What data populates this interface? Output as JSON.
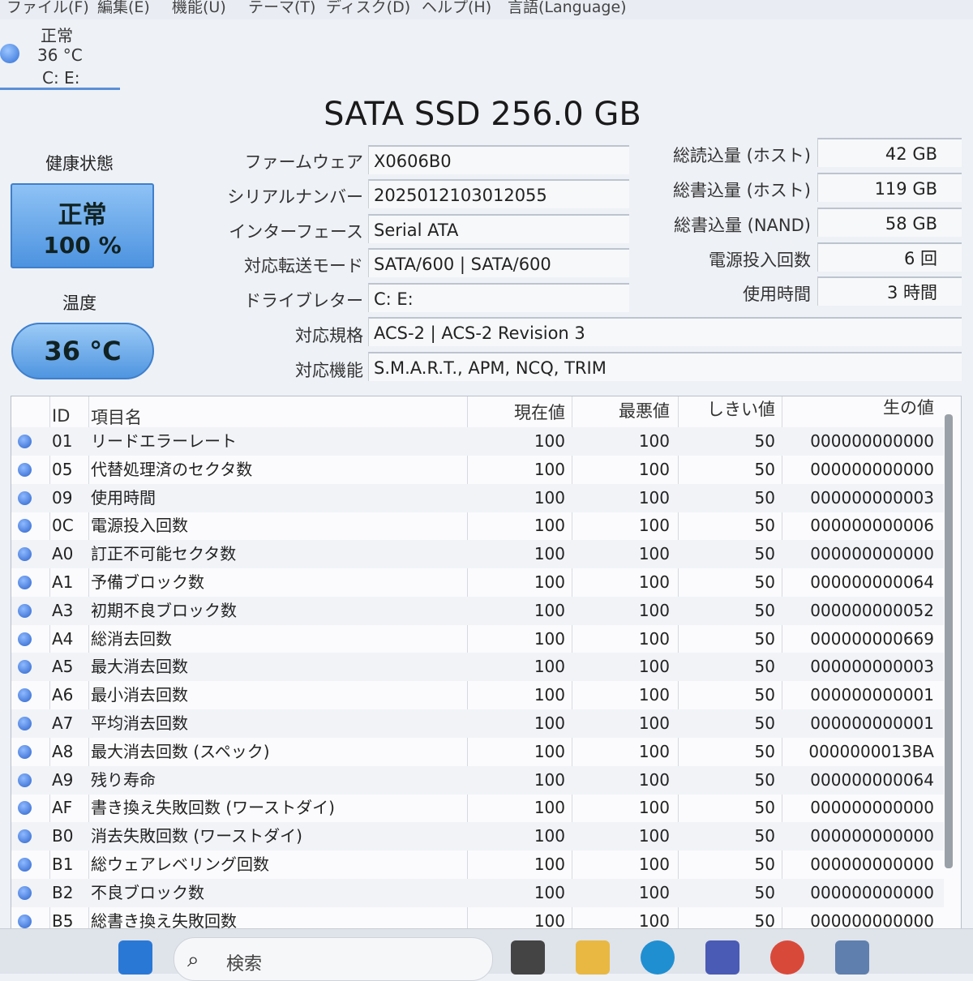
{
  "menu": [
    "ファイル(F)",
    "編集(E)",
    "機能(U)",
    "テーマ(T)",
    "ディスク(D)",
    "ヘルプ(H)",
    "言語(Language)"
  ],
  "drive_tab": {
    "status": "正常",
    "temp": "36 °C",
    "letters": "C: E:"
  },
  "title": "SATA SSD 256.0 GB",
  "health": {
    "label": "健康状態",
    "status": "正常",
    "percent": "100 %"
  },
  "temperature": {
    "label": "温度",
    "value": "36 °C"
  },
  "info_left": [
    {
      "label": "ファームウェア",
      "value": "X0606B0"
    },
    {
      "label": "シリアルナンバー",
      "value": "2025012103012055"
    },
    {
      "label": "インターフェース",
      "value": "Serial ATA"
    },
    {
      "label": "対応転送モード",
      "value": "SATA/600 | SATA/600"
    },
    {
      "label": "ドライブレター",
      "value": "C: E:"
    }
  ],
  "info_wide": [
    {
      "label": "対応規格",
      "value": "ACS-2 | ACS-2 Revision 3"
    },
    {
      "label": "対応機能",
      "value": "S.M.A.R.T., APM, NCQ, TRIM"
    }
  ],
  "info_right": [
    {
      "label": "総読込量 (ホスト)",
      "value": "42 GB"
    },
    {
      "label": "総書込量 (ホスト)",
      "value": "119 GB"
    },
    {
      "label": "総書込量 (NAND)",
      "value": "58 GB"
    },
    {
      "label": "電源投入回数",
      "value": "6 回"
    },
    {
      "label": "使用時間",
      "value": "3 時間"
    }
  ],
  "table": {
    "headers": [
      "ID",
      "項目名",
      "現在値",
      "最悪値",
      "しきい値",
      "生の値"
    ],
    "rows": [
      {
        "id": "01",
        "name": "リードエラーレート",
        "cur": "100",
        "worst": "100",
        "thr": "50",
        "raw": "000000000000"
      },
      {
        "id": "05",
        "name": "代替処理済のセクタ数",
        "cur": "100",
        "worst": "100",
        "thr": "50",
        "raw": "000000000000"
      },
      {
        "id": "09",
        "name": "使用時間",
        "cur": "100",
        "worst": "100",
        "thr": "50",
        "raw": "000000000003"
      },
      {
        "id": "0C",
        "name": "電源投入回数",
        "cur": "100",
        "worst": "100",
        "thr": "50",
        "raw": "000000000006"
      },
      {
        "id": "A0",
        "name": "訂正不可能セクタ数",
        "cur": "100",
        "worst": "100",
        "thr": "50",
        "raw": "000000000000"
      },
      {
        "id": "A1",
        "name": "予備ブロック数",
        "cur": "100",
        "worst": "100",
        "thr": "50",
        "raw": "000000000064"
      },
      {
        "id": "A3",
        "name": "初期不良ブロック数",
        "cur": "100",
        "worst": "100",
        "thr": "50",
        "raw": "000000000052"
      },
      {
        "id": "A4",
        "name": "総消去回数",
        "cur": "100",
        "worst": "100",
        "thr": "50",
        "raw": "000000000669"
      },
      {
        "id": "A5",
        "name": "最大消去回数",
        "cur": "100",
        "worst": "100",
        "thr": "50",
        "raw": "000000000003"
      },
      {
        "id": "A6",
        "name": "最小消去回数",
        "cur": "100",
        "worst": "100",
        "thr": "50",
        "raw": "000000000001"
      },
      {
        "id": "A7",
        "name": "平均消去回数",
        "cur": "100",
        "worst": "100",
        "thr": "50",
        "raw": "000000000001"
      },
      {
        "id": "A8",
        "name": "最大消去回数 (スペック)",
        "cur": "100",
        "worst": "100",
        "thr": "50",
        "raw": "0000000013BA"
      },
      {
        "id": "A9",
        "name": "残り寿命",
        "cur": "100",
        "worst": "100",
        "thr": "50",
        "raw": "000000000064"
      },
      {
        "id": "AF",
        "name": "書き換え失敗回数 (ワーストダイ)",
        "cur": "100",
        "worst": "100",
        "thr": "50",
        "raw": "000000000000"
      },
      {
        "id": "B0",
        "name": "消去失敗回数 (ワーストダイ)",
        "cur": "100",
        "worst": "100",
        "thr": "50",
        "raw": "000000000000"
      },
      {
        "id": "B1",
        "name": "総ウェアレベリング回数",
        "cur": "100",
        "worst": "100",
        "thr": "50",
        "raw": "000000000000"
      },
      {
        "id": "B2",
        "name": "不良ブロック数",
        "cur": "100",
        "worst": "100",
        "thr": "50",
        "raw": "000000000000"
      },
      {
        "id": "B5",
        "name": "総書き換え失敗回数",
        "cur": "100",
        "worst": "100",
        "thr": "50",
        "raw": "000000000000"
      }
    ]
  },
  "taskbar": {
    "search_placeholder": "検索"
  }
}
